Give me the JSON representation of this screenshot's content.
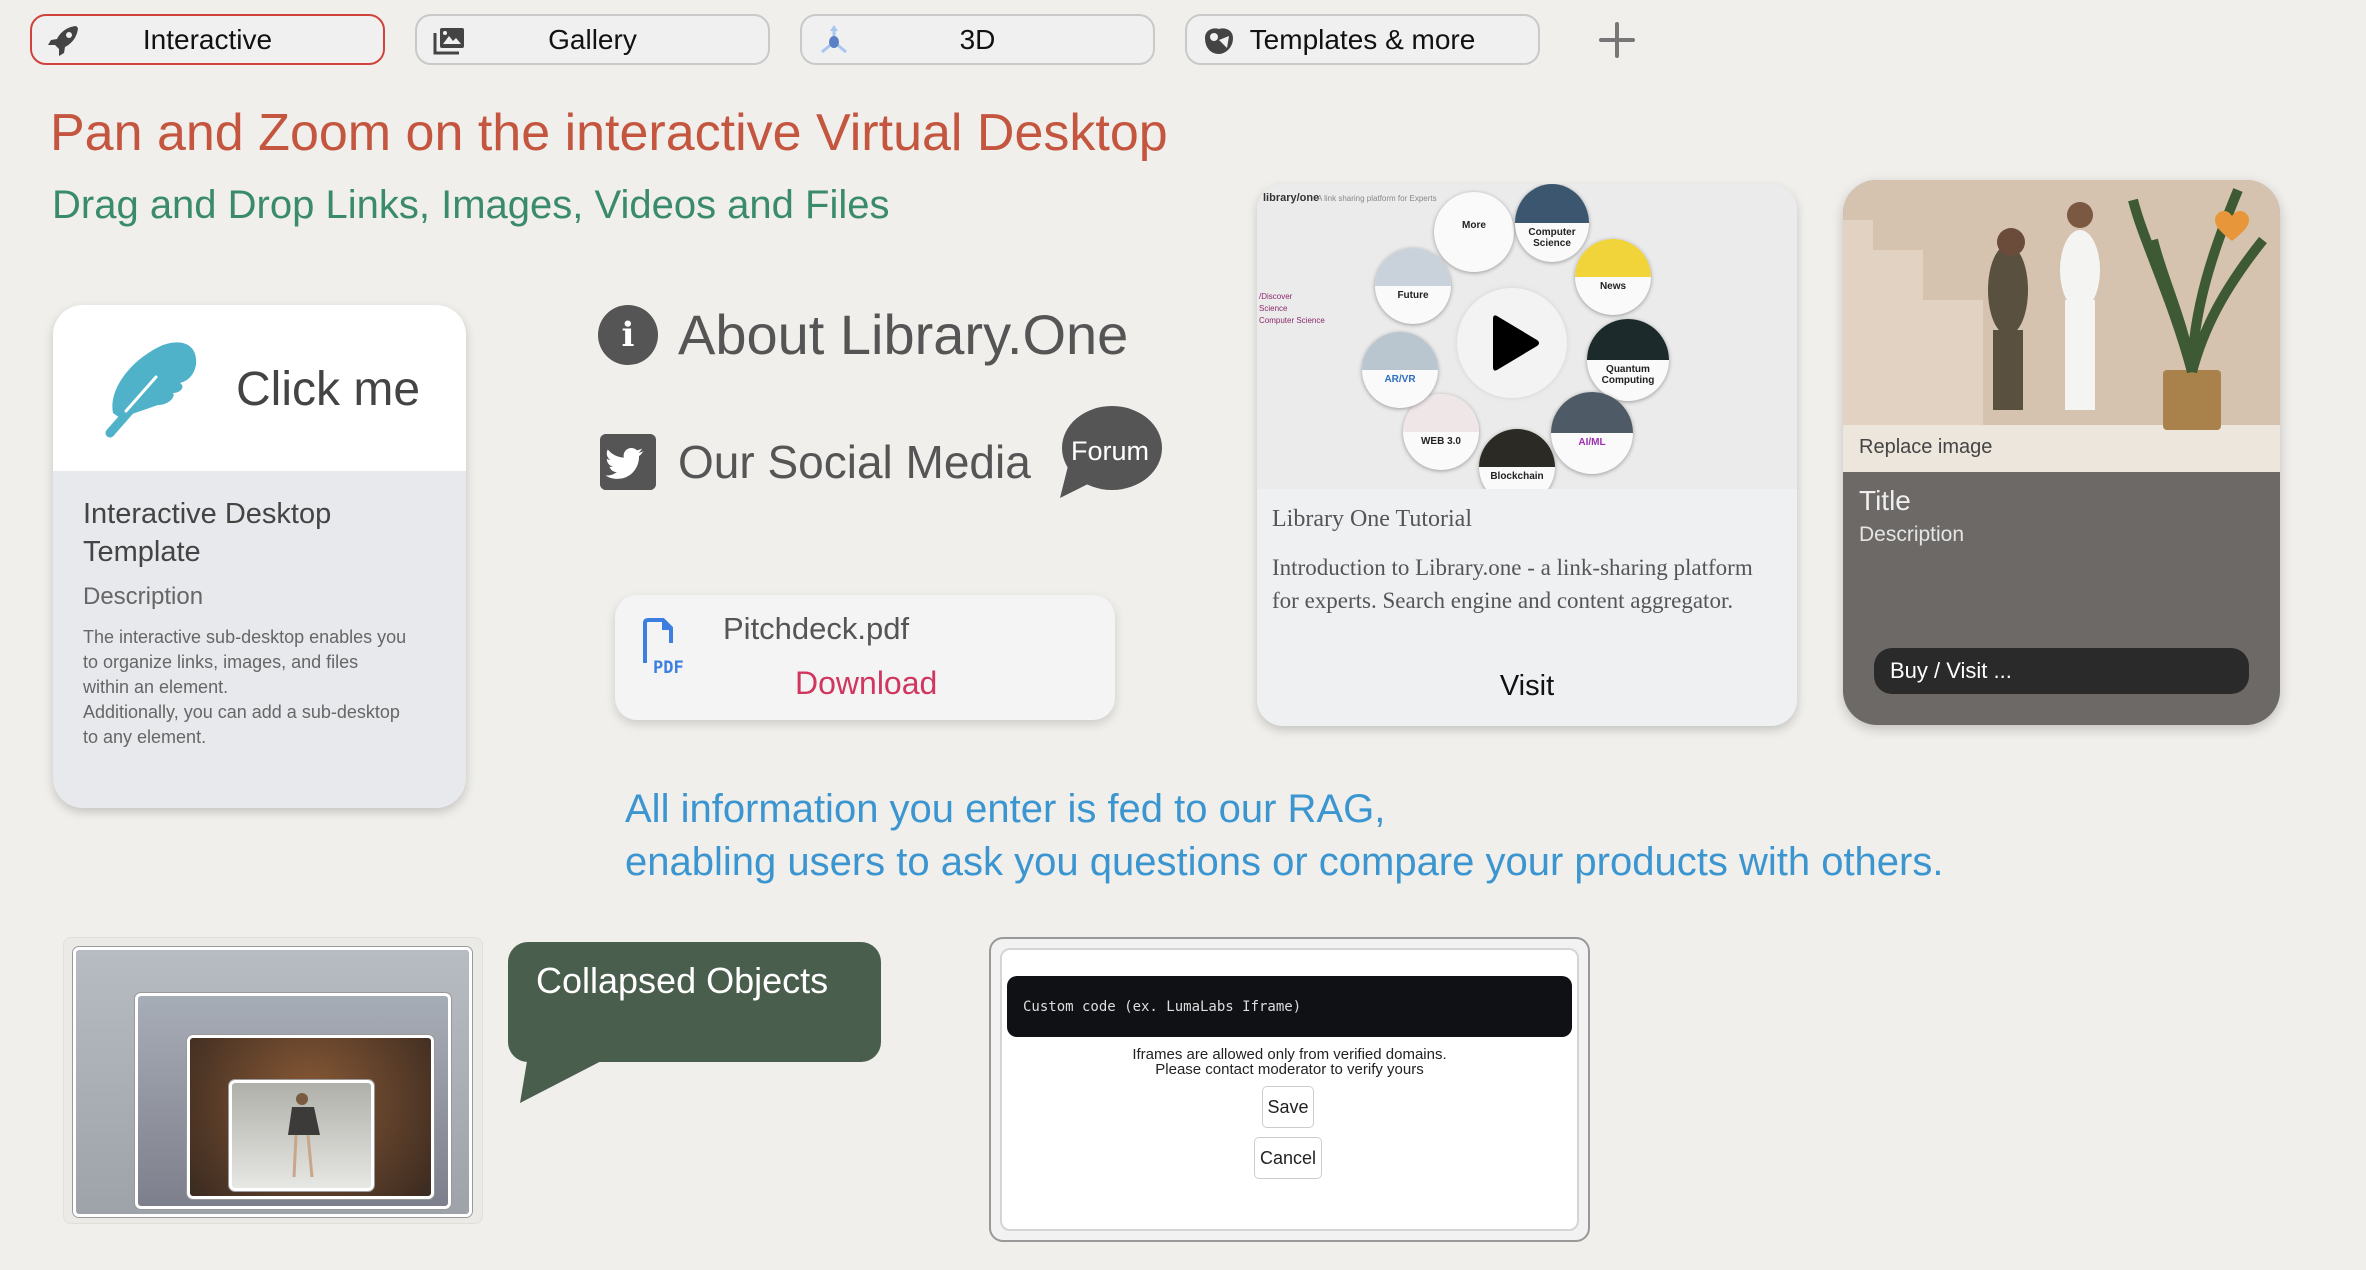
{
  "tabs": [
    {
      "label": "Interactive",
      "icon": "rocket-icon",
      "active": true
    },
    {
      "label": "Gallery",
      "icon": "gallery-icon",
      "active": false
    },
    {
      "label": "3D",
      "icon": "3d-axes-icon",
      "active": false
    },
    {
      "label": "Templates & more",
      "icon": "templates-icon",
      "active": false
    }
  ],
  "add_tab_icon": "plus-icon",
  "headline": "Pan and Zoom on the interactive Virtual Desktop",
  "subheadline": "Drag and Drop Links, Images, Videos and Files",
  "template_card": {
    "button_label": "Click me",
    "icon": "feather-icon",
    "title": "Interactive Desktop Template",
    "description_heading": "Description",
    "description": "The interactive sub-desktop enables you\nto organize links, images, and files\nwithin an element.\nAdditionally, you can add a sub-desktop\nto any element."
  },
  "about_link": {
    "label": "About Library.One",
    "icon": "info-icon",
    "icon_glyph": "i"
  },
  "social_link": {
    "label": "Our Social Media",
    "icon": "twitter-icon"
  },
  "forum_bubble": {
    "label": "Forum"
  },
  "pdf_card": {
    "filename": "Pitchdeck.pdf",
    "action": "Download",
    "icon_text": "PDF"
  },
  "video_card": {
    "thumbnail": {
      "brand": "library/one",
      "tagline": "A link sharing platform for Experts",
      "sidebar": [
        "/Discover",
        "Science",
        "Computer Science"
      ],
      "nodes": [
        "More",
        "Computer Science",
        "News",
        "Quantum Computing",
        "AI/ML",
        "Blockchain",
        "WEB 3.0",
        "AR/VR",
        "Future"
      ]
    },
    "title": "Library One Tutorial",
    "description": "Introduction to Library.one - a link-sharing platform for experts. Search engine and content aggregator.",
    "visit_label": "Visit"
  },
  "product_card": {
    "replace_label": "Replace image",
    "title": "Title",
    "description": "Description",
    "buy_label": "Buy / Visit ...",
    "favorite": true
  },
  "rag_text": "All information you enter is fed to our RAG,\nenabling users to ask you questions or compare your products with others.",
  "collapsed_bubble": {
    "label": "Collapsed Objects"
  },
  "custom_code": {
    "placeholder": "Custom code (ex. LumaLabs Iframe)",
    "value": "",
    "note": "Iframes are allowed only from verified domains.\nPlease contact moderator to verify yours",
    "save_label": "Save",
    "cancel_label": "Cancel"
  },
  "colors": {
    "background": "#f0efeb",
    "active_tab_border": "#d0433a",
    "headline": "#c4553f",
    "subheadline": "#3a8a6e",
    "rag_text": "#3b95d0",
    "download": "#d0365f",
    "feather": "#4fb2c9",
    "heart": "#e8963a",
    "bubble": "#4a5e4d"
  }
}
